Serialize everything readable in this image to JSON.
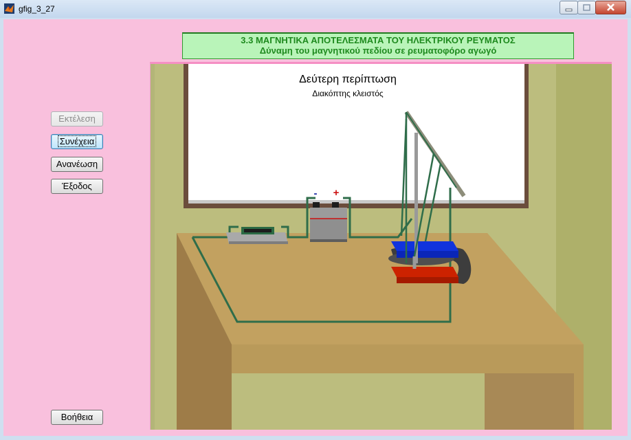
{
  "window": {
    "title": "gfig_3_27",
    "icon": "matlab-logo-icon"
  },
  "heading": {
    "line1": "3.3 ΜΑΓΝΗΤΙΚΑ ΑΠΟΤΕΛΕΣΜΑΤΑ ΤΟΥ ΗΛΕΚΤΡΙΚΟΥ ΡΕΥΜΑΤΟΣ",
    "line2": "Δύναμη του μαγνητικού πεδίου σε ρευματοφόρο αγωγό"
  },
  "buttons": {
    "run": "Εκτέλεση",
    "continue": "Συνέχεια",
    "refresh": "Ανανέωση",
    "exit": "Έξοδος",
    "help": "Βοήθεια"
  },
  "scene": {
    "board_title": "Δεύτερη περίπτωση",
    "board_subtitle": "Διακόπτης κλειστός",
    "battery_minus": "-",
    "battery_plus": "+"
  },
  "colors": {
    "background": "#f9c0dd",
    "heading_bg": "#b9f4b9",
    "heading_text": "#1e8a1e",
    "wire": "#2e6b4a",
    "magnet_north": "#1133dd",
    "magnet_south": "#cc2200"
  }
}
